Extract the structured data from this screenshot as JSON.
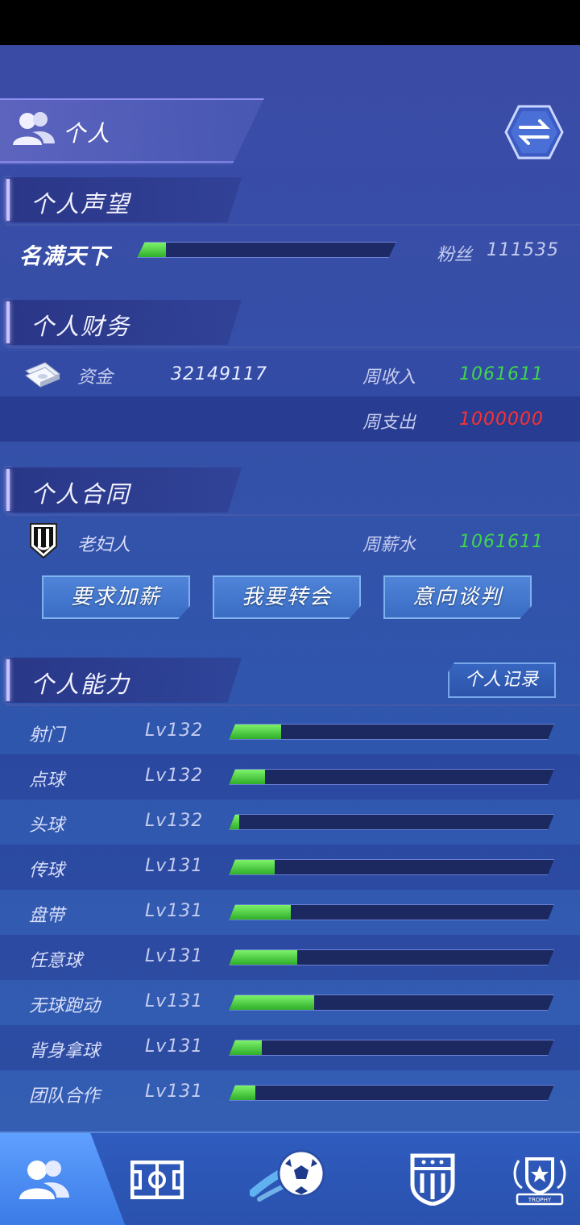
{
  "header": {
    "title": "个人"
  },
  "reputation": {
    "section_title": "个人声望",
    "rank": "名满天下",
    "progress": 0.11,
    "fans_label": "粉丝",
    "fans_value": "111535"
  },
  "finance": {
    "section_title": "个人财务",
    "funds_label": "资金",
    "funds_value": "32149117",
    "weekly_income_label": "周收入",
    "weekly_income_value": "1061611",
    "weekly_expense_label": "周支出",
    "weekly_expense_value": "1000000"
  },
  "contract": {
    "section_title": "个人合同",
    "club": "老妇人",
    "weekly_salary_label": "周薪水",
    "weekly_salary_value": "1061611",
    "buttons": [
      "要求加薪",
      "我要转会",
      "意向谈判"
    ]
  },
  "abilities": {
    "section_title": "个人能力",
    "record_button": "个人记录",
    "items": [
      {
        "name": "射门",
        "level": "Lv132",
        "progress": 0.16
      },
      {
        "name": "点球",
        "level": "Lv132",
        "progress": 0.11
      },
      {
        "name": "头球",
        "level": "Lv132",
        "progress": 0.03
      },
      {
        "name": "传球",
        "level": "Lv131",
        "progress": 0.14
      },
      {
        "name": "盘带",
        "level": "Lv131",
        "progress": 0.19
      },
      {
        "name": "任意球",
        "level": "Lv131",
        "progress": 0.21
      },
      {
        "name": "无球跑动",
        "level": "Lv131",
        "progress": 0.26
      },
      {
        "name": "背身拿球",
        "level": "Lv131",
        "progress": 0.1
      },
      {
        "name": "团队合作",
        "level": "Lv131",
        "progress": 0.08
      }
    ]
  },
  "nav": {
    "items": [
      "players-icon",
      "pitch-icon",
      "soccer-ball-icon",
      "club-badge-icon",
      "trophy-icon"
    ],
    "trophy_text": "TROPHY",
    "active": 0
  },
  "colors": {
    "positive": "#3fd64a",
    "negative": "#ff3030",
    "bar_fill": "#49c93a"
  }
}
